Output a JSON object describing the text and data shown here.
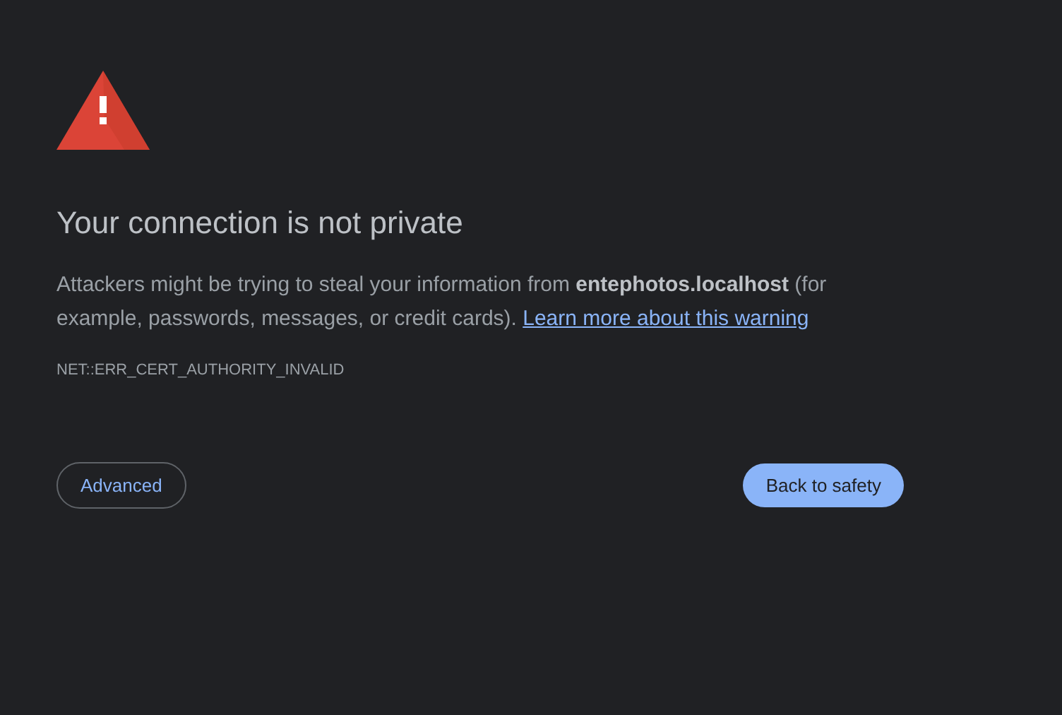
{
  "heading": "Your connection is not private",
  "description": "Attackers might be trying to steal your information from **entephotos.localhost** (for example, passwords, messages, or credit cards).",
  "learn_more_link": "Learn more about this warning",
  "error_code": "NET::ERR_CERT_AUTHORITY_INVALID",
  "buttons": [
    {
      "label": "Advanced",
      "kind": "outlined"
    },
    {
      "label": "Back to safety",
      "kind": "primary"
    }
  ]
}
